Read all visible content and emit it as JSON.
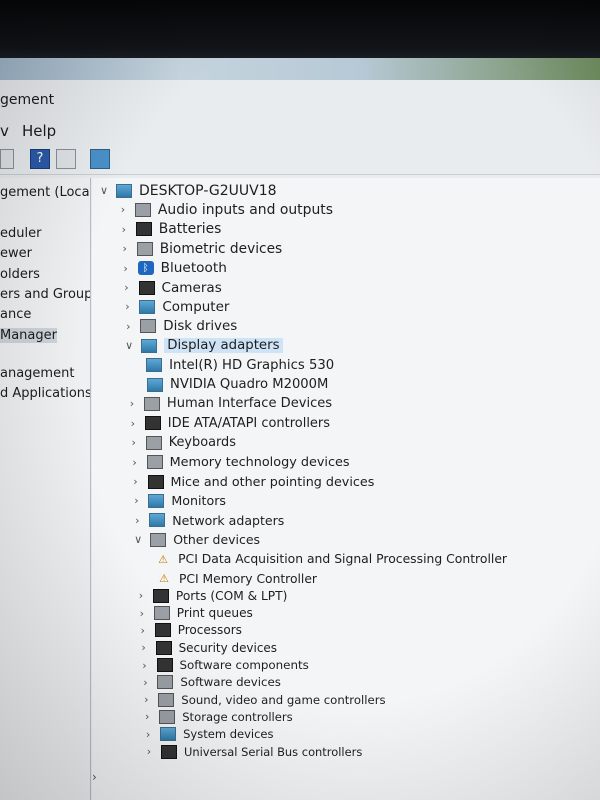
{
  "window_title": "gement",
  "menu": {
    "view_fragment": "v",
    "help": "Help"
  },
  "left_pane": {
    "header": "gement (Local",
    "items": [
      {
        "label": "eduler"
      },
      {
        "label": "ewer"
      },
      {
        "label": "olders"
      },
      {
        "label": "ers and Groups"
      },
      {
        "label": "ance"
      },
      {
        "label": "Manager",
        "selected": true
      },
      {
        "label": "anagement"
      },
      {
        "label": "d Applications"
      }
    ]
  },
  "tree": {
    "root": "DESKTOP-G2UUV18",
    "categories": [
      {
        "label": "Audio inputs and outputs",
        "icon": "speaker-icon"
      },
      {
        "label": "Batteries",
        "icon": "battery-icon"
      },
      {
        "label": "Biometric devices",
        "icon": "fingerprint-icon"
      },
      {
        "label": "Bluetooth",
        "icon": "bluetooth-icon"
      },
      {
        "label": "Cameras",
        "icon": "camera-icon"
      },
      {
        "label": "Computer",
        "icon": "computer-icon"
      },
      {
        "label": "Disk drives",
        "icon": "disk-drive-icon"
      },
      {
        "label": "Display adapters",
        "icon": "display-adapter-icon",
        "expanded": true,
        "selected": true,
        "children": [
          "Intel(R) HD Graphics 530",
          "NVIDIA Quadro M2000M"
        ]
      },
      {
        "label": "Human Interface Devices",
        "icon": "hid-icon"
      },
      {
        "label": "IDE ATA/ATAPI controllers",
        "icon": "ide-controller-icon"
      },
      {
        "label": "Keyboards",
        "icon": "keyboard-icon"
      },
      {
        "label": "Memory technology devices",
        "icon": "memory-icon"
      },
      {
        "label": "Mice and other pointing devices",
        "icon": "mouse-icon"
      },
      {
        "label": "Monitors",
        "icon": "monitor-icon"
      },
      {
        "label": "Network adapters",
        "icon": "network-adapter-icon"
      },
      {
        "label": "Other devices",
        "icon": "other-devices-icon",
        "expanded": true,
        "children": [
          "PCI Data Acquisition and Signal Processing Controller",
          "PCI Memory Controller"
        ]
      },
      {
        "label": "Ports (COM & LPT)",
        "icon": "port-icon"
      },
      {
        "label": "Print queues",
        "icon": "printer-icon"
      },
      {
        "label": "Processors",
        "icon": "processor-icon"
      },
      {
        "label": "Security devices",
        "icon": "security-device-icon"
      },
      {
        "label": "Software components",
        "icon": "software-component-icon"
      },
      {
        "label": "Software devices",
        "icon": "software-device-icon"
      },
      {
        "label": "Sound, video and game controllers",
        "icon": "sound-icon"
      },
      {
        "label": "Storage controllers",
        "icon": "storage-controller-icon"
      },
      {
        "label": "System devices",
        "icon": "system-device-icon"
      },
      {
        "label": "Universal Serial Bus controllers",
        "icon": "usb-icon"
      }
    ]
  }
}
